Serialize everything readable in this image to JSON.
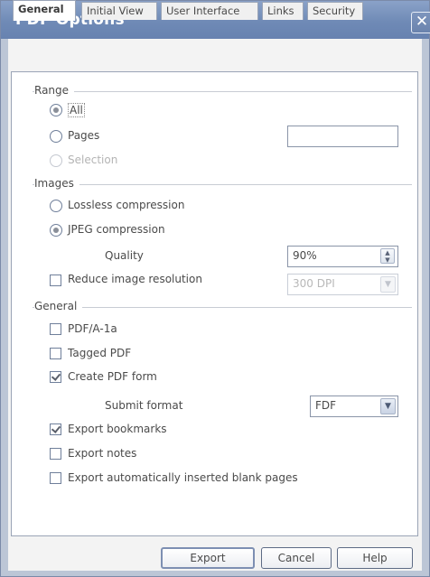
{
  "window": {
    "title": "PDF Options",
    "close_glyph": "✕"
  },
  "tabs": [
    {
      "label": "General",
      "active": true
    },
    {
      "label": "Initial View",
      "active": false
    },
    {
      "label": "User Interface",
      "active": false
    },
    {
      "label": "Links",
      "active": false
    },
    {
      "label": "Security",
      "active": false
    }
  ],
  "range": {
    "heading": "Range",
    "all_label": "All",
    "all_checked": true,
    "pages_label": "Pages",
    "pages_checked": false,
    "pages_value": "",
    "selection_label": "Selection",
    "selection_enabled": false
  },
  "images": {
    "heading": "Images",
    "lossless_label": "Lossless compression",
    "lossless_checked": false,
    "jpeg_label": "JPEG compression",
    "jpeg_checked": true,
    "quality_label": "Quality",
    "quality_value": "90%",
    "reduce_label": "Reduce image resolution",
    "reduce_checked": false,
    "resolution_value": "300 DPI"
  },
  "general": {
    "heading": "General",
    "pdfa_label": "PDF/A-1a",
    "pdfa_checked": false,
    "tagged_label": "Tagged PDF",
    "tagged_checked": false,
    "form_label": "Create PDF form",
    "form_checked": true,
    "submit_label": "Submit format",
    "submit_value": "FDF",
    "bookmarks_label": "Export bookmarks",
    "bookmarks_checked": true,
    "notes_label": "Export notes",
    "notes_checked": false,
    "blank_label": "Export automatically inserted blank pages",
    "blank_checked": false
  },
  "buttons": {
    "export": "Export",
    "cancel": "Cancel",
    "help": "Help"
  },
  "icons": {
    "spin_up": "▲",
    "spin_down": "▼",
    "dropdown": "▼"
  }
}
